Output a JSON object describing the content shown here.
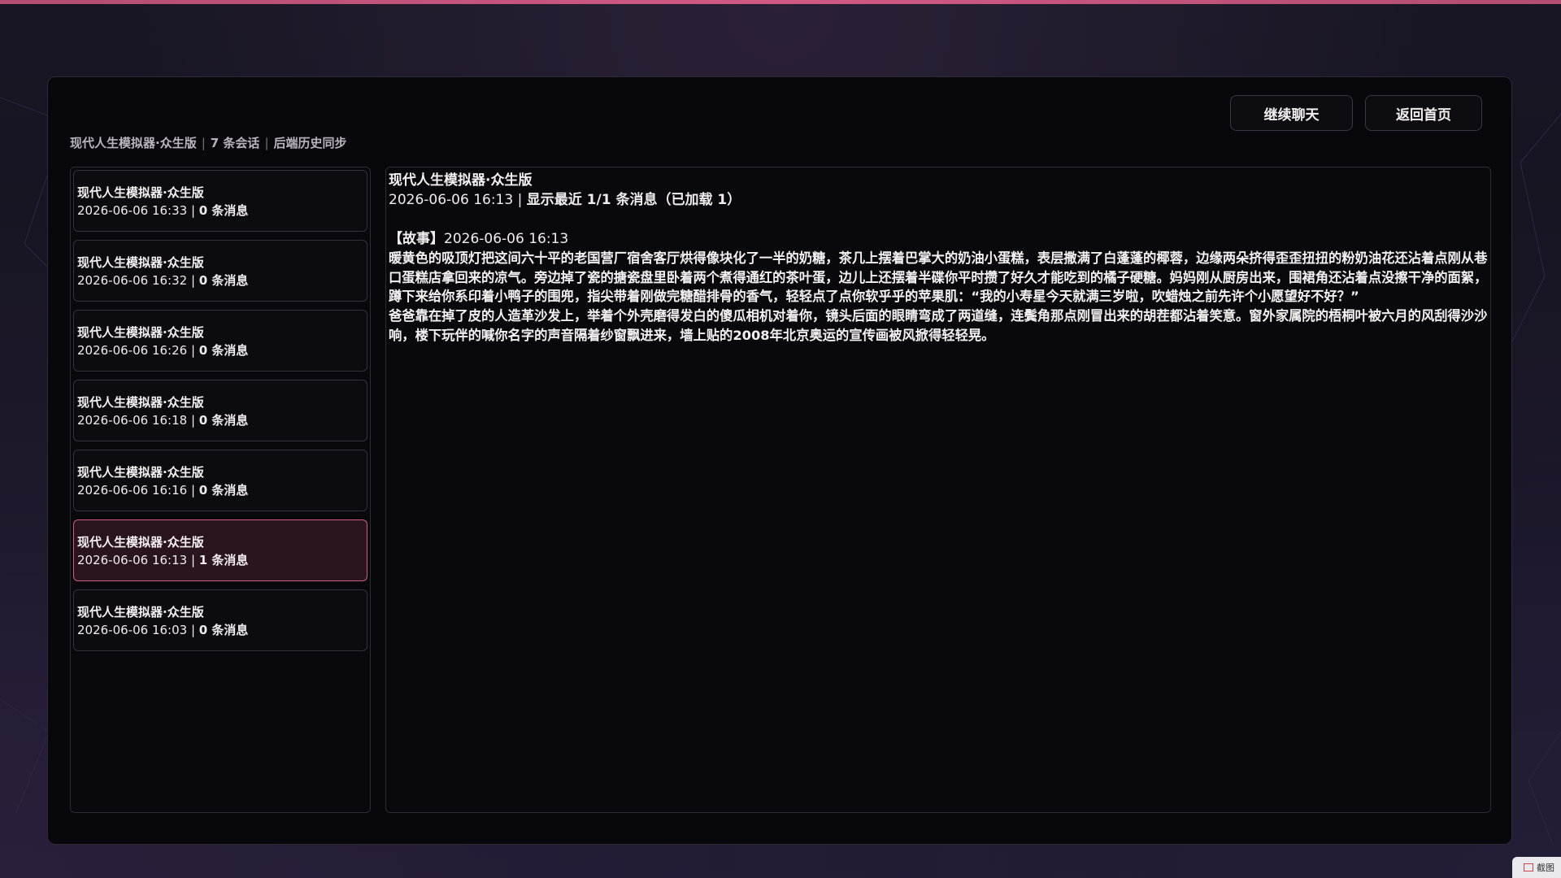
{
  "header": {
    "continue_label": "继续聊天",
    "home_label": "返回首页"
  },
  "meta": {
    "app_name": "现代人生模拟器·众生版",
    "session_count": "7 条会话",
    "sync_status": "后端历史同步"
  },
  "sessions": [
    {
      "title": "现代人生模拟器·众生版",
      "time": "2026-06-06 16:33",
      "count": "0 条消息",
      "active": false
    },
    {
      "title": "现代人生模拟器·众生版",
      "time": "2026-06-06 16:32",
      "count": "0 条消息",
      "active": false
    },
    {
      "title": "现代人生模拟器·众生版",
      "time": "2026-06-06 16:26",
      "count": "0 条消息",
      "active": false
    },
    {
      "title": "现代人生模拟器·众生版",
      "time": "2026-06-06 16:18",
      "count": "0 条消息",
      "active": false
    },
    {
      "title": "现代人生模拟器·众生版",
      "time": "2026-06-06 16:16",
      "count": "0 条消息",
      "active": false
    },
    {
      "title": "现代人生模拟器·众生版",
      "time": "2026-06-06 16:13",
      "count": "1 条消息",
      "active": true
    },
    {
      "title": "现代人生模拟器·众生版",
      "time": "2026-06-06 16:03",
      "count": "0 条消息",
      "active": false
    }
  ],
  "detail": {
    "title": "现代人生模拟器·众生版",
    "time": "2026-06-06 16:13",
    "info": "显示最近 1/1 条消息（已加载 1）",
    "message": {
      "tag": "【故事】",
      "time": "2026-06-06 16:13",
      "body": "暖黄色的吸顶灯把这间六十平的老国营厂宿舍客厅烘得像块化了一半的奶糖，茶几上摆着巴掌大的奶油小蛋糕，表层撒满了白蓬蓬的椰蓉，边缘两朵挤得歪歪扭扭的粉奶油花还沾着点刚从巷口蛋糕店拿回来的凉气。旁边掉了瓷的搪瓷盘里卧着两个煮得通红的茶叶蛋，边儿上还摆着半碟你平时攒了好久才能吃到的橘子硬糖。妈妈刚从厨房出来，围裙角还沾着点没擦干净的面絮，蹲下来给你系印着小鸭子的围兜，指尖带着刚做完糖醋排骨的香气，轻轻点了点你软乎乎的苹果肌：“我的小寿星今天就满三岁啦，吹蜡烛之前先许个小愿望好不好？”\n爸爸靠在掉了皮的人造革沙发上，举着个外壳磨得发白的傻瓜相机对着你，镜头后面的眼睛弯成了两道缝，连鬓角那点刚冒出来的胡茬都沾着笑意。窗外家属院的梧桐叶被六月的风刮得沙沙响，楼下玩伴的喊你名字的声音隔着纱窗飘进来，墙上贴的2008年北京奥运的宣传画被风掀得轻轻晃。"
    }
  },
  "corner": {
    "label": "截图"
  },
  "colors": {
    "accent": "#cf5d86",
    "active_bg": "#2a1420",
    "panel_bg": "#08070b"
  }
}
